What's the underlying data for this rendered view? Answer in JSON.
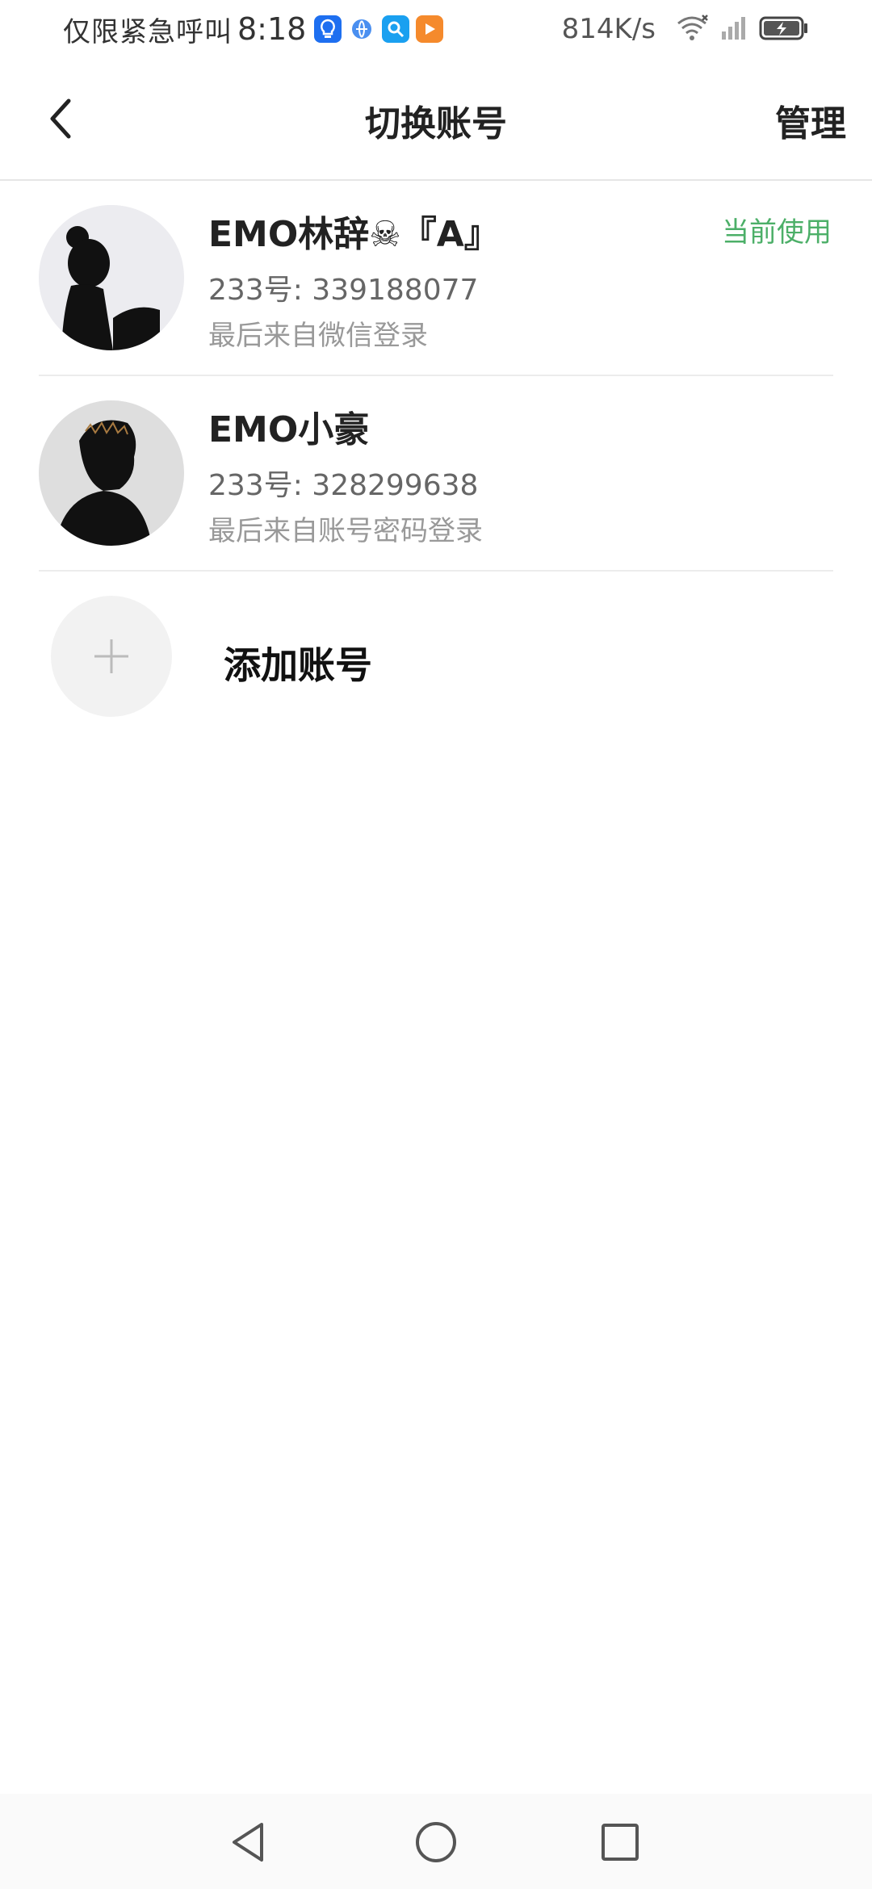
{
  "status_bar": {
    "carrier": "仅限紧急呼叫",
    "time": "8:18",
    "net_speed": "814K/s",
    "notification_icons": [
      "bulb-app-icon",
      "browser-app-icon",
      "search-app-icon",
      "video-app-icon"
    ],
    "colors": {
      "bulb": "#1e6ff0",
      "browser": "#4a8ff0",
      "search": "#1aa0f0",
      "video": "#f58a2c"
    }
  },
  "app_bar": {
    "back_icon": "chevron-left-icon",
    "title": "切换账号",
    "manage_label": "管理"
  },
  "accounts": [
    {
      "name": "EMO林辞☠『A』",
      "id_text": "233号: 339188077",
      "login_text": "最后来自微信登录",
      "badge": "当前使用",
      "avatar": "silhouette-girl-avatar"
    },
    {
      "name": "EMO小豪",
      "id_text": "233号: 328299638",
      "login_text": "最后来自账号密码登录",
      "badge": "",
      "avatar": "silhouette-boy-avatar"
    }
  ],
  "add_account": {
    "label": "添加账号",
    "icon": "plus-icon"
  },
  "accent_color": "#4caf68",
  "nav_bar": {
    "icons": [
      "back-triangle-icon",
      "home-circle-icon",
      "recents-square-icon"
    ]
  }
}
